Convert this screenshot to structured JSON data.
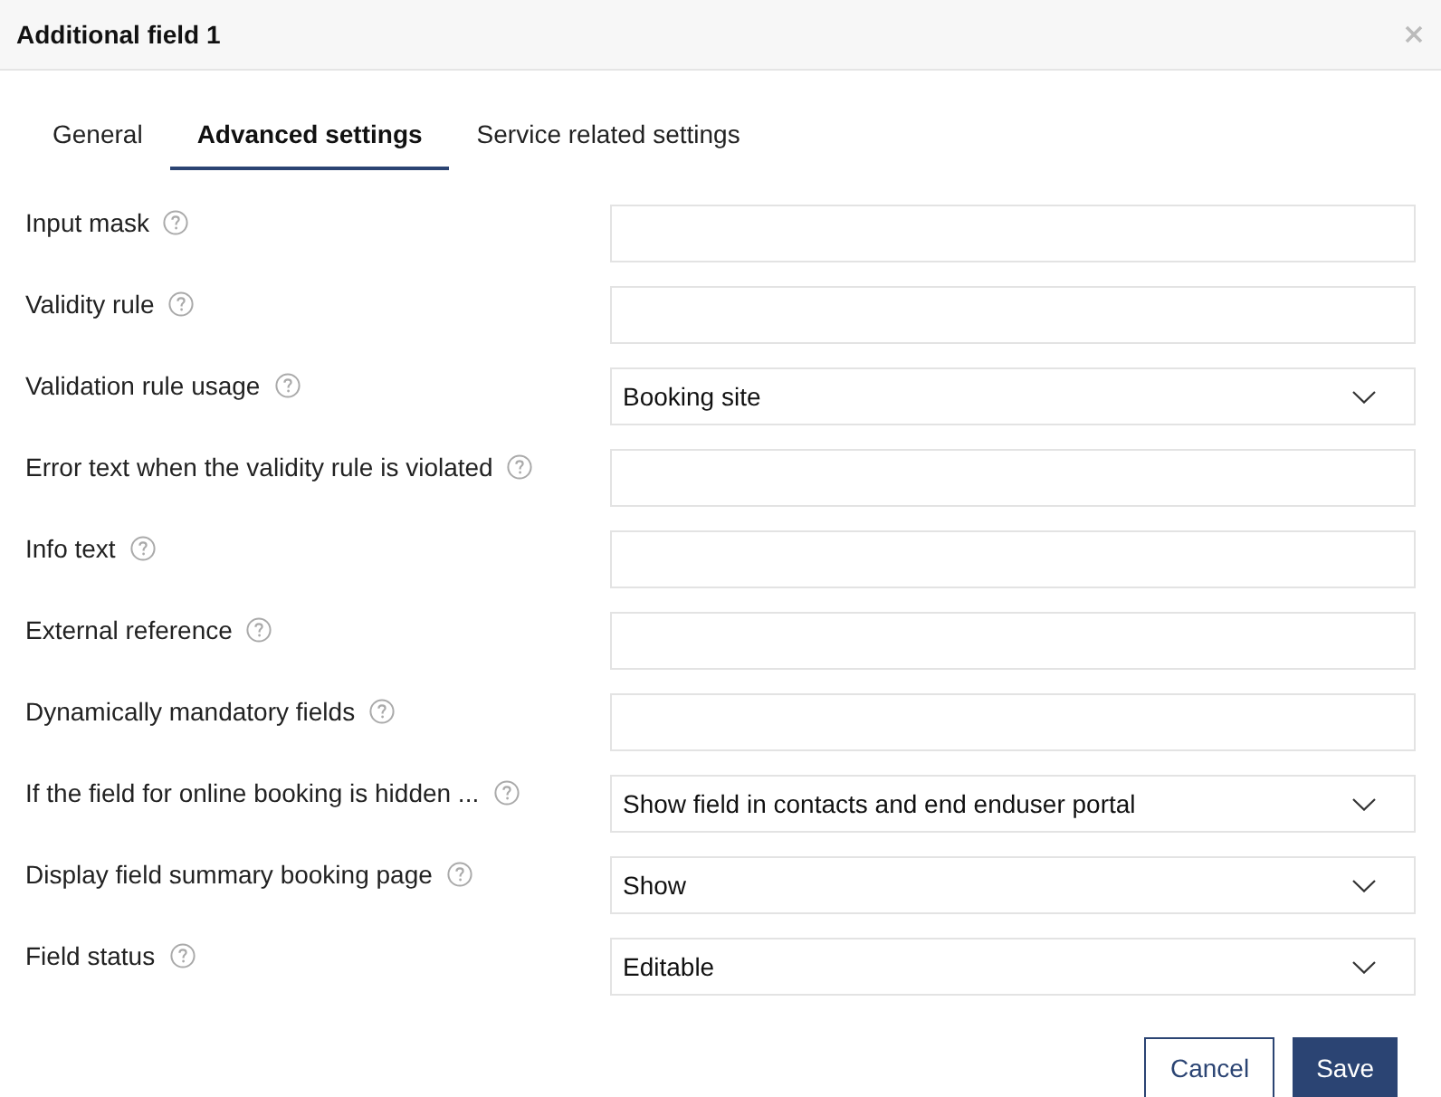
{
  "dialog": {
    "title": "Additional field 1"
  },
  "tabs": [
    {
      "label": "General",
      "selected": false
    },
    {
      "label": "Advanced settings",
      "selected": true
    },
    {
      "label": "Service related settings",
      "selected": false
    }
  ],
  "fields": [
    {
      "label": "Input mask",
      "kind": "text"
    },
    {
      "label": "Validity rule",
      "kind": "text"
    },
    {
      "label": "Validation rule usage",
      "kind": "select",
      "value": "Booking site"
    },
    {
      "label": "Error text when the validity rule is violated",
      "kind": "text"
    },
    {
      "label": "Info text",
      "kind": "text"
    },
    {
      "label": "External reference",
      "kind": "text"
    },
    {
      "label": "Dynamically mandatory fields",
      "kind": "text"
    },
    {
      "label": "If the field for online booking is hidden ...",
      "kind": "select",
      "value": "Show field in contacts and end enduser portal"
    },
    {
      "label": "Display field summary booking page",
      "kind": "select",
      "value": "Show"
    },
    {
      "label": "Field status",
      "kind": "select",
      "value": "Editable"
    }
  ],
  "buttons": [
    {
      "label": "Cancel",
      "kind": "secondary"
    },
    {
      "label": "Save",
      "kind": "primary"
    }
  ]
}
